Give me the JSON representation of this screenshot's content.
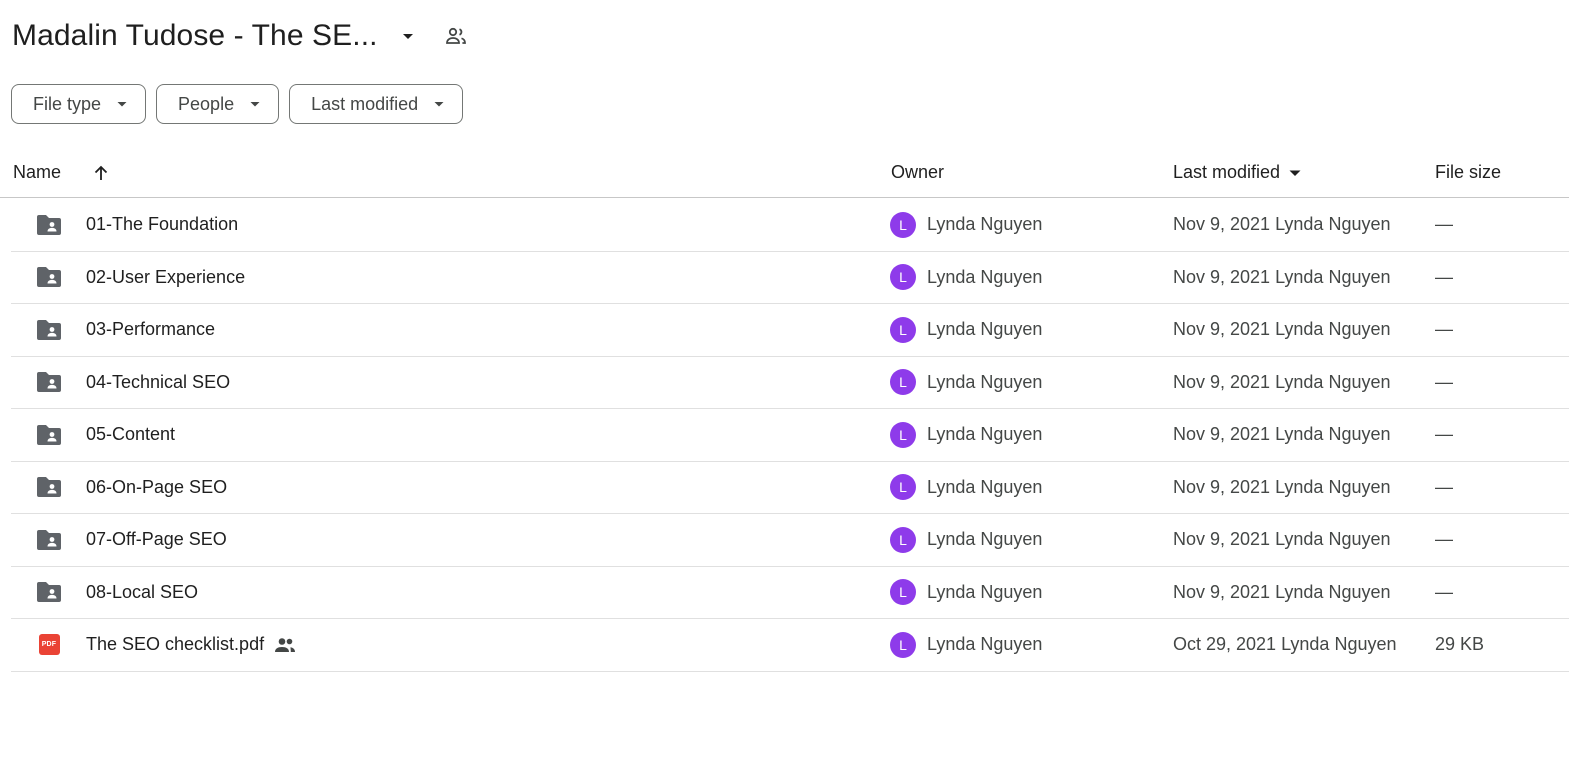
{
  "header": {
    "title": "Madalin Tudose - The SE...",
    "caret_icon": "arrow-drop-down-icon",
    "shared_icon": "people-outline-icon"
  },
  "filters": [
    {
      "label": "File type"
    },
    {
      "label": "People"
    },
    {
      "label": "Last modified"
    }
  ],
  "columns": {
    "name": "Name",
    "owner": "Owner",
    "last_modified": "Last modified",
    "file_size": "File size"
  },
  "colors": {
    "avatar": "#8e3bea",
    "folder_icon": "#5f6368",
    "pdf_icon": "#ea4335"
  },
  "rows": [
    {
      "type": "shared-folder",
      "name": "01-The Foundation",
      "owner_initial": "L",
      "owner": "Lynda Nguyen",
      "modified": "Nov 9, 2021 Lynda Nguyen",
      "size": "—"
    },
    {
      "type": "shared-folder",
      "name": "02-User Experience",
      "owner_initial": "L",
      "owner": "Lynda Nguyen",
      "modified": "Nov 9, 2021 Lynda Nguyen",
      "size": "—"
    },
    {
      "type": "shared-folder",
      "name": "03-Performance",
      "owner_initial": "L",
      "owner": "Lynda Nguyen",
      "modified": "Nov 9, 2021 Lynda Nguyen",
      "size": "—"
    },
    {
      "type": "shared-folder",
      "name": "04-Technical SEO",
      "owner_initial": "L",
      "owner": "Lynda Nguyen",
      "modified": "Nov 9, 2021 Lynda Nguyen",
      "size": "—"
    },
    {
      "type": "shared-folder",
      "name": "05-Content",
      "owner_initial": "L",
      "owner": "Lynda Nguyen",
      "modified": "Nov 9, 2021 Lynda Nguyen",
      "size": "—"
    },
    {
      "type": "shared-folder",
      "name": "06-On-Page SEO",
      "owner_initial": "L",
      "owner": "Lynda Nguyen",
      "modified": "Nov 9, 2021 Lynda Nguyen",
      "size": "—"
    },
    {
      "type": "shared-folder",
      "name": "07-Off-Page SEO",
      "owner_initial": "L",
      "owner": "Lynda Nguyen",
      "modified": "Nov 9, 2021 Lynda Nguyen",
      "size": "—"
    },
    {
      "type": "shared-folder",
      "name": "08-Local SEO",
      "owner_initial": "L",
      "owner": "Lynda Nguyen",
      "modified": "Nov 9, 2021 Lynda Nguyen",
      "size": "—"
    },
    {
      "type": "pdf",
      "pdf_label": "PDF",
      "name": "The SEO checklist.pdf",
      "shared": true,
      "owner_initial": "L",
      "owner": "Lynda Nguyen",
      "modified": "Oct 29, 2021 Lynda Nguyen",
      "size": "29 KB"
    }
  ]
}
